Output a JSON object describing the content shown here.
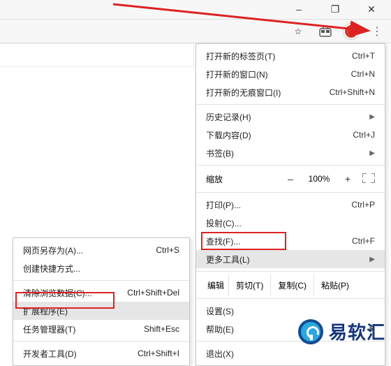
{
  "window": {
    "minimize": "–",
    "maximize": "❐",
    "close": "✕"
  },
  "toolbar": {
    "star": "☆",
    "ext": "▣",
    "menu": "⋮"
  },
  "mainmenu": {
    "new_tab": {
      "label": "打开新的标签页(T)",
      "kbd": "Ctrl+T"
    },
    "new_window": {
      "label": "打开新的窗口(N)",
      "kbd": "Ctrl+N"
    },
    "incognito": {
      "label": "打开新的无痕窗口(I)",
      "kbd": "Ctrl+Shift+N"
    },
    "history": {
      "label": "历史记录(H)"
    },
    "downloads": {
      "label": "下载内容(D)",
      "kbd": "Ctrl+J"
    },
    "bookmarks": {
      "label": "书签(B)"
    },
    "zoom": {
      "label": "缩放",
      "minus": "–",
      "value": "100%",
      "plus": "+"
    },
    "print": {
      "label": "打印(P)...",
      "kbd": "Ctrl+P"
    },
    "cast": {
      "label": "投射(C)..."
    },
    "find": {
      "label": "查找(F)...",
      "kbd": "Ctrl+F"
    },
    "more_tools": {
      "label": "更多工具(L)"
    },
    "edit": {
      "label": "编辑",
      "cut": "剪切(T)",
      "copy": "复制(C)",
      "paste": "粘贴(P)"
    },
    "settings": {
      "label": "设置(S)"
    },
    "help": {
      "label": "帮助(E)"
    },
    "exit": {
      "label": "退出(X)"
    }
  },
  "submenu": {
    "save_as": {
      "label": "网页另存为(A)...",
      "kbd": "Ctrl+S"
    },
    "shortcut": {
      "label": "创建快捷方式..."
    },
    "clear_data": {
      "label": "清除浏览数据(C)...",
      "kbd": "Ctrl+Shift+Del"
    },
    "extensions": {
      "label": "扩展程序(E)"
    },
    "task_mgr": {
      "label": "任务管理器(T)",
      "kbd": "Shift+Esc"
    },
    "devtools": {
      "label": "开发者工具(D)",
      "kbd": "Ctrl+Shift+I"
    }
  },
  "watermark": "易软汇"
}
